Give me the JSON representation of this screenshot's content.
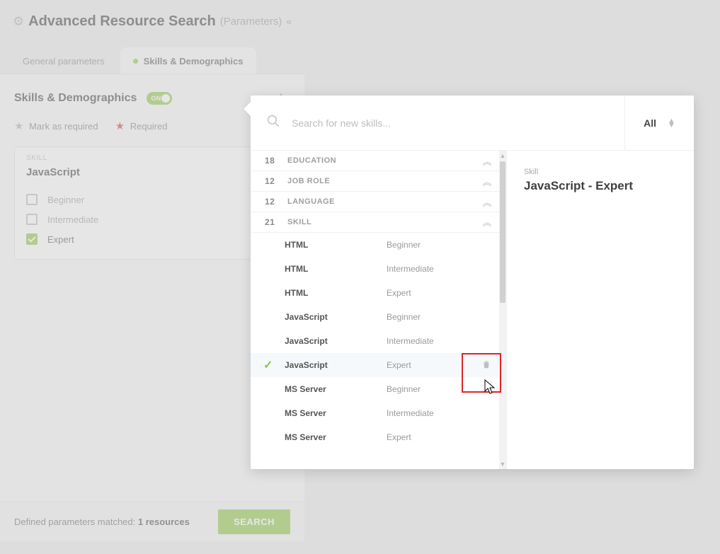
{
  "header": {
    "title": "Advanced Resource Search",
    "subtitle": "(Parameters)"
  },
  "tabs": {
    "general": "General parameters",
    "skills": "Skills & Demographics"
  },
  "section": {
    "title": "Skills & Demographics",
    "toggle_label": "ON",
    "legend_mark": "Mark as required",
    "legend_req": "Required"
  },
  "card": {
    "label": "SKILL",
    "skill": "JavaScript",
    "levels": [
      "Beginner",
      "Intermediate",
      "Expert"
    ],
    "checked_index": 2
  },
  "footer": {
    "text_prefix": "Defined parameters matched: ",
    "count": "1 resources",
    "search": "SEARCH"
  },
  "popover": {
    "search_placeholder": "Search for new skills...",
    "filter_label": "All",
    "categories": [
      {
        "count": "18",
        "name": "EDUCATION",
        "expanded": false
      },
      {
        "count": "12",
        "name": "JOB ROLE",
        "expanded": false
      },
      {
        "count": "12",
        "name": "LANGUAGE",
        "expanded": false
      },
      {
        "count": "21",
        "name": "SKILL",
        "expanded": true
      }
    ],
    "items": [
      {
        "name": "HTML",
        "level": "Beginner",
        "selected": false
      },
      {
        "name": "HTML",
        "level": "Intermediate",
        "selected": false
      },
      {
        "name": "HTML",
        "level": "Expert",
        "selected": false
      },
      {
        "name": "JavaScript",
        "level": "Beginner",
        "selected": false
      },
      {
        "name": "JavaScript",
        "level": "Intermediate",
        "selected": false
      },
      {
        "name": "JavaScript",
        "level": "Expert",
        "selected": true
      },
      {
        "name": "MS Server",
        "level": "Beginner",
        "selected": false
      },
      {
        "name": "MS Server",
        "level": "Intermediate",
        "selected": false
      },
      {
        "name": "MS Server",
        "level": "Expert",
        "selected": false
      }
    ],
    "details_label": "Skill",
    "details_value": "JavaScript - Expert"
  }
}
